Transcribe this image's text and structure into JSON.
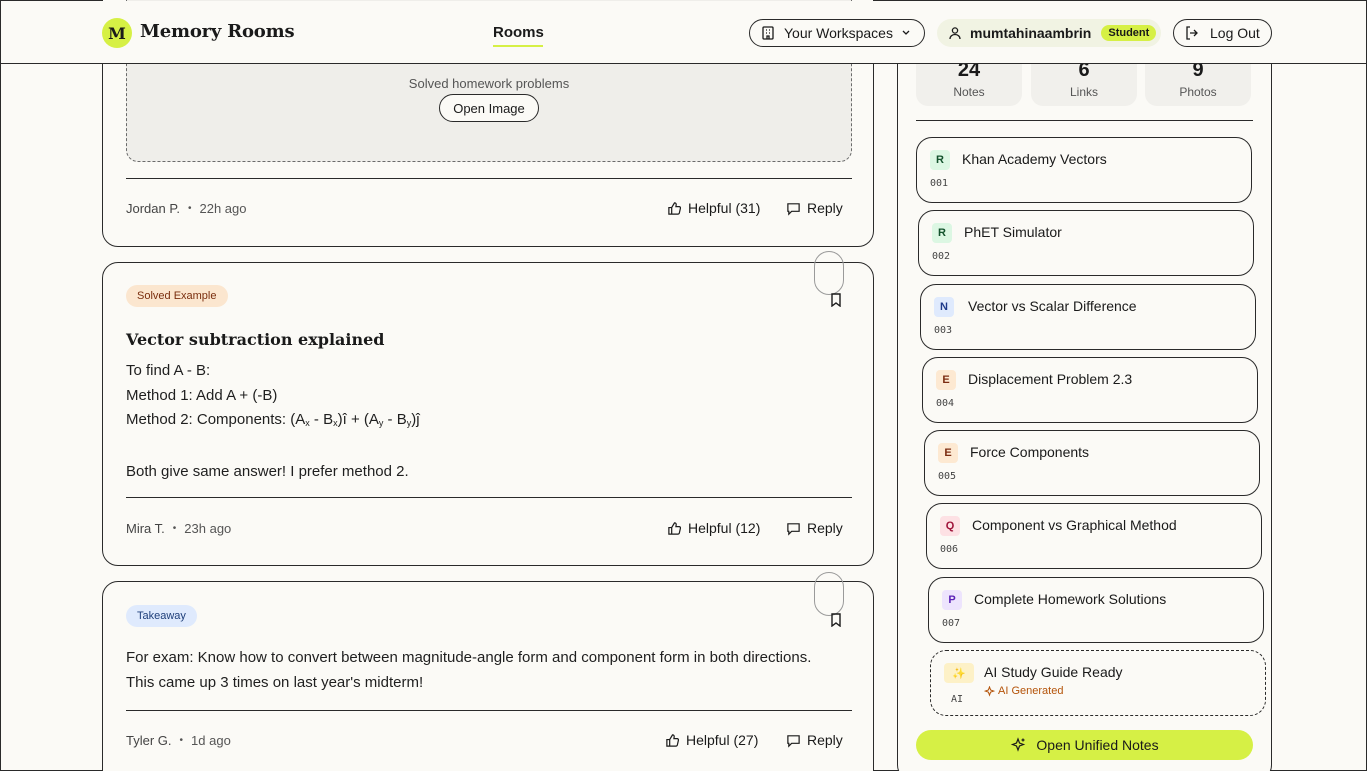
{
  "app": {
    "logo_letter": "M",
    "name": "Memory Rooms"
  },
  "nav": {
    "rooms_label": "Rooms"
  },
  "header": {
    "workspaces_label": "Your Workspaces",
    "username": "mumtahinaambrin",
    "role_badge": "Student",
    "logout_label": "Log Out"
  },
  "posts": [
    {
      "image_caption": "Solved homework problems",
      "open_image_label": "Open Image",
      "author": "Jordan P.",
      "time": "22h ago",
      "helpful_label": "Helpful (31)",
      "reply_label": "Reply"
    },
    {
      "tag": "Solved Example",
      "title": "Vector subtraction explained",
      "body_line1": "To find A - B:",
      "body_line2": "Method 1: Add A + (-B)",
      "body_line3_prefix": "Method 2: Components: (A",
      "sub_x": "x",
      "sub_y": "y",
      "minus_b": " - B",
      "close_i": ")î + (A",
      "close_j": ")ĵ",
      "body_line4": "Both give same answer! I prefer method 2.",
      "author": "Mira T.",
      "time": "23h ago",
      "helpful_label": "Helpful (12)",
      "reply_label": "Reply"
    },
    {
      "tag": "Takeaway",
      "body": "For exam: Know how to convert between magnitude-angle form and component form in both directions. This came up 3 times on last year's midterm!",
      "author": "Tyler G.",
      "time": "1d ago",
      "helpful_label": "Helpful (27)",
      "reply_label": "Reply"
    }
  ],
  "sidebar": {
    "stats": [
      {
        "value": "24",
        "label": "Notes"
      },
      {
        "value": "6",
        "label": "Links"
      },
      {
        "value": "9",
        "label": "Photos"
      }
    ],
    "sources": [
      {
        "badge": "R",
        "title": "Khan Academy Vectors",
        "num": "001"
      },
      {
        "badge": "R",
        "title": "PhET Simulator",
        "num": "002"
      },
      {
        "badge": "N",
        "title": "Vector vs Scalar Difference",
        "num": "003"
      },
      {
        "badge": "E",
        "title": "Displacement Problem 2.3",
        "num": "004"
      },
      {
        "badge": "E",
        "title": "Force Components",
        "num": "005"
      },
      {
        "badge": "Q",
        "title": "Component vs Graphical Method",
        "num": "006"
      },
      {
        "badge": "P",
        "title": "Complete Homework Solutions",
        "num": "007"
      },
      {
        "badge": "✨",
        "title": "AI Study Guide Ready",
        "num": "AI",
        "sub": "AI Generated"
      }
    ],
    "unified_label": "Open Unified Notes"
  }
}
